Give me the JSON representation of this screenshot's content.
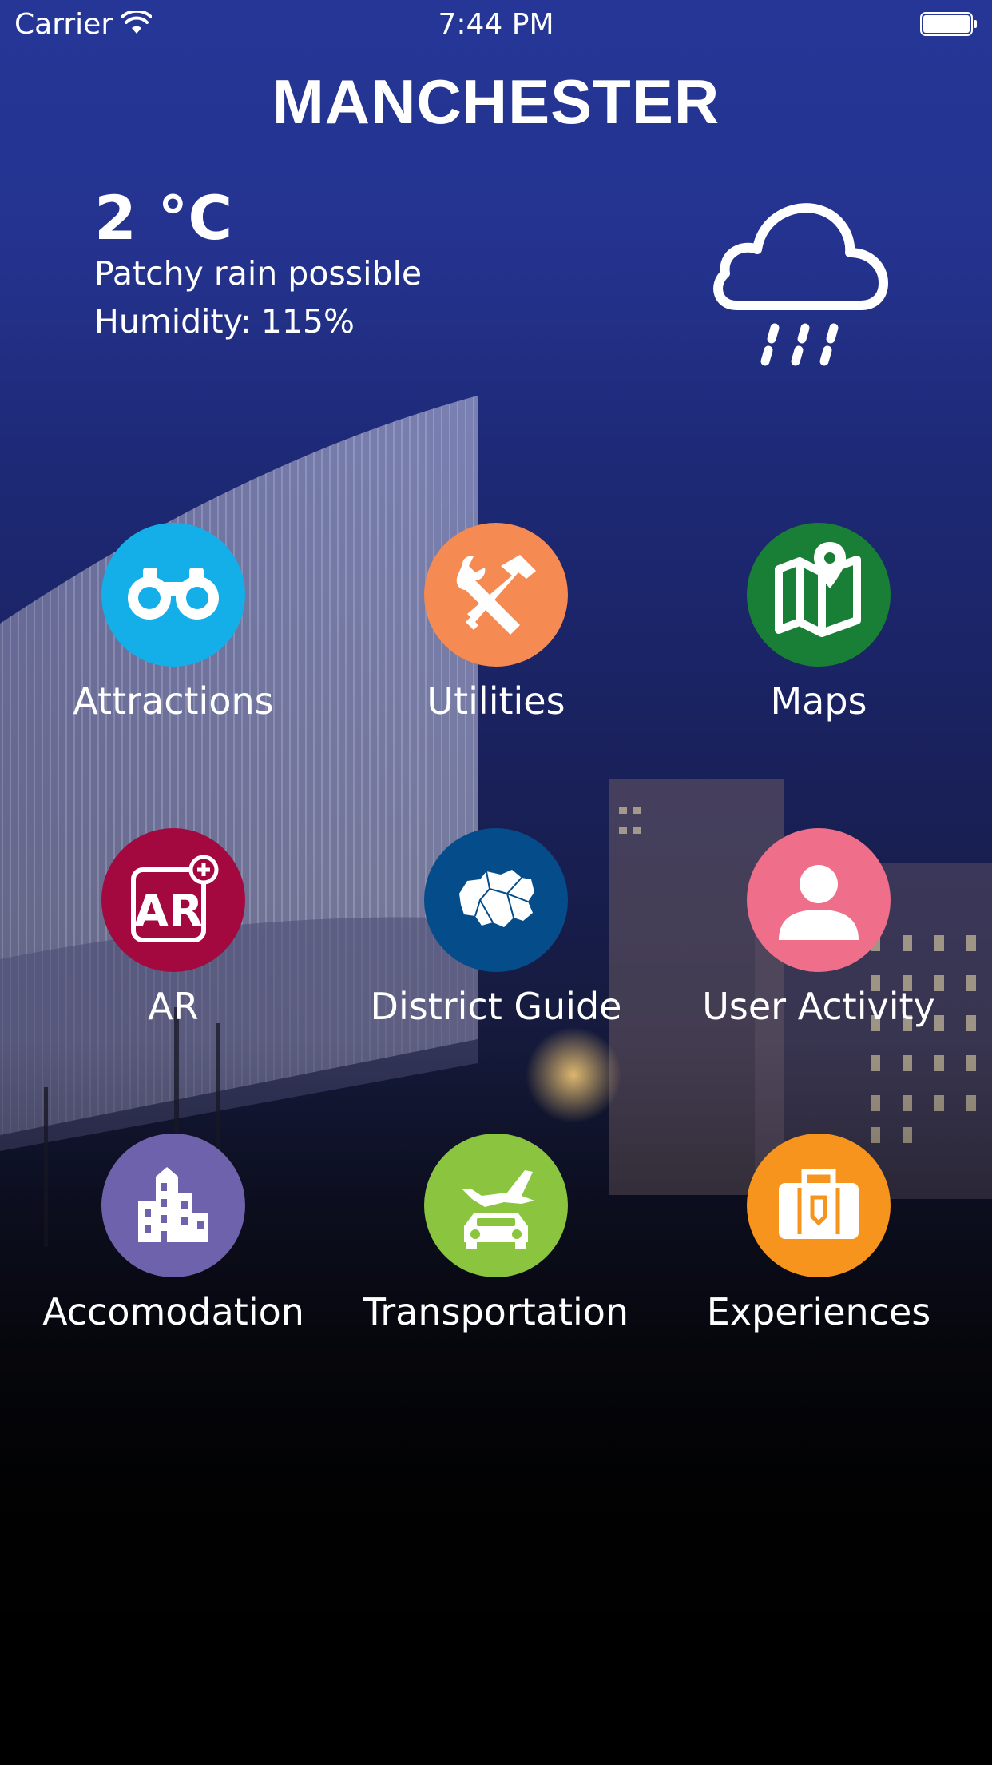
{
  "status_bar": {
    "carrier": "Carrier",
    "time": "7:44 PM",
    "wifi_icon": "wifi-icon",
    "battery_icon": "battery-icon"
  },
  "header": {
    "city": "MANCHESTER"
  },
  "weather": {
    "temperature": "2 °C",
    "description": "Patchy rain possible",
    "humidity_label": "Humidity:",
    "humidity_value": "115%",
    "icon": "cloud-rain-icon"
  },
  "menu": {
    "items": [
      {
        "label": "Attractions",
        "icon": "binoculars-icon",
        "color": "#14aee9"
      },
      {
        "label": "Utilities",
        "icon": "tools-icon",
        "color": "#f58b52"
      },
      {
        "label": "Maps",
        "icon": "map-icon",
        "color": "#1a7f36"
      },
      {
        "label": "AR",
        "icon": "ar-icon",
        "color": "#a3083f"
      },
      {
        "label": "District Guide",
        "icon": "district-map-icon",
        "color": "#044d8a"
      },
      {
        "label": "User Activity",
        "icon": "user-icon",
        "color": "#ef6f8b"
      },
      {
        "label": "Accomodation",
        "icon": "building-icon",
        "color": "#6f62ad"
      },
      {
        "label": "Transportation",
        "icon": "transport-icon",
        "color": "#8bc53f"
      },
      {
        "label": "Experiences",
        "icon": "suitcase-icon",
        "color": "#f7941d"
      }
    ]
  }
}
